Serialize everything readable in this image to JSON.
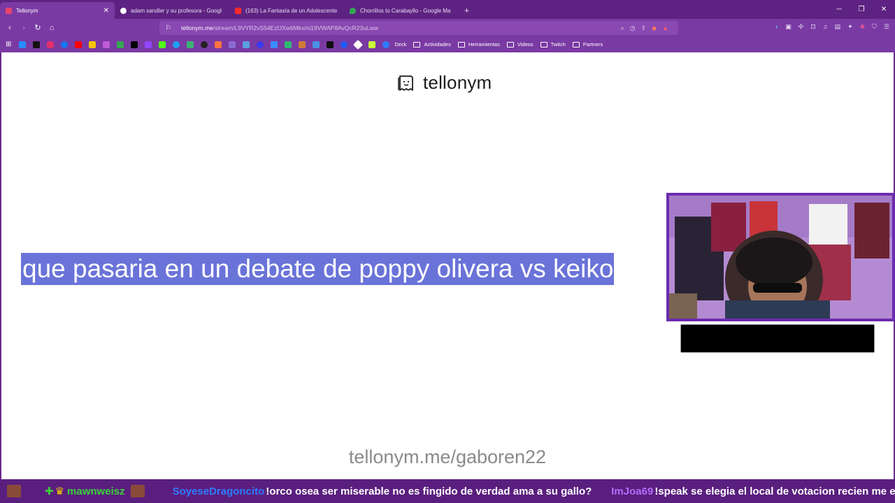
{
  "browser": {
    "tabs": [
      {
        "title": "Tellonym",
        "active": true,
        "favicon_color": "#e8456b"
      },
      {
        "title": "adam sandler y su profesora - Googl",
        "active": false,
        "favicon_color": "#ffffff"
      },
      {
        "title": "(163) La Fantasía de un Adolescente",
        "active": false,
        "favicon_color": "#ff2b2b"
      },
      {
        "title": "Chorrillos to Carabayllo - Google Ma",
        "active": false,
        "favicon_color": "#34a853"
      }
    ],
    "url_host": "tellonym.me",
    "url_path": "/stream/L9VYR2vS54EzfJXw6Mkxmi19VWAP8AvQcR23uLww",
    "bookmarks": [
      {
        "label": "Deck"
      },
      {
        "label": "Actividades"
      },
      {
        "label": "Herramientas"
      },
      {
        "label": "Videos"
      },
      {
        "label": "Twitch"
      },
      {
        "label": "Partners"
      }
    ]
  },
  "page": {
    "logo_text": "tellonym",
    "question": "que pasaria en un debate de poppy olivera vs keiko",
    "profile_link": "tellonym.me/gaboren22"
  },
  "chat": [
    {
      "user": "mawnweisz",
      "user_color": "#3ad13a",
      "message": ""
    },
    {
      "user": "SoyeseDragoncito",
      "user_color": "#2f7bff",
      "message": "!orco osea ser miserable no es fingido de verdad ama a su gallo?"
    },
    {
      "user": "ImJoa69",
      "user_color": "#b46cff",
      "message": "!speak se elegia el local de votacion recien me entero"
    }
  ],
  "colors": {
    "question_highlight": "#6a73d8",
    "browser_accent": "#7a3aa3"
  }
}
